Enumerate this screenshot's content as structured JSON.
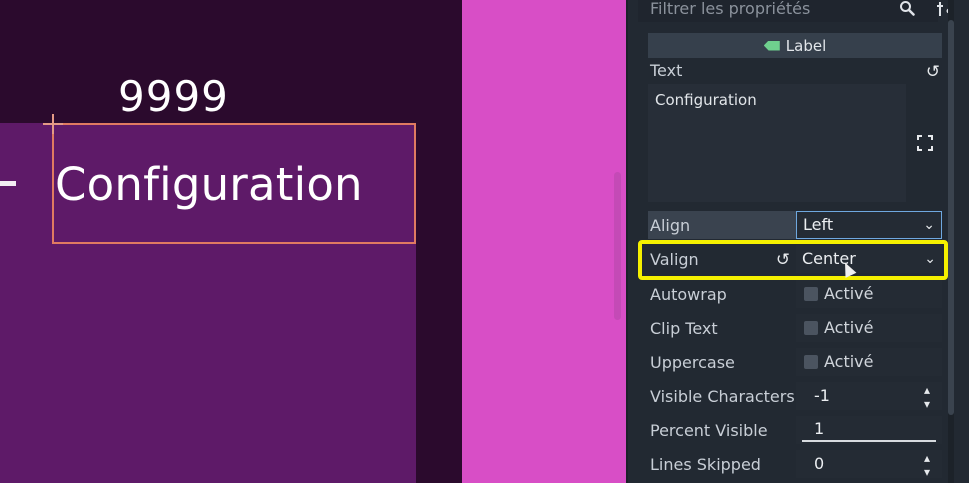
{
  "viewport": {
    "counter_text": "9999",
    "label_text": "Configuration"
  },
  "inspector": {
    "filter": {
      "placeholder": "Filtrer les propriétés",
      "search_icon": "search-icon",
      "tools_icon": "tools-icon"
    },
    "section_header": "Label",
    "text": {
      "label": "Text",
      "value": "Configuration"
    },
    "align": {
      "label": "Align",
      "value": "Left"
    },
    "valign": {
      "label": "Valign",
      "value": "Center"
    },
    "checkboxes": [
      {
        "label": "Autowrap",
        "value_label": "Activé",
        "checked": false
      },
      {
        "label": "Clip Text",
        "value_label": "Activé",
        "checked": false
      },
      {
        "label": "Uppercase",
        "value_label": "Activé",
        "checked": false
      }
    ],
    "visible_characters": {
      "label": "Visible Characters",
      "value": "-1"
    },
    "percent_visible": {
      "label": "Percent Visible",
      "value": "1",
      "fraction": 1
    },
    "lines_skipped": {
      "label": "Lines Skipped",
      "value": "0"
    }
  },
  "colors": {
    "viewport_dark": "#2b0a2d",
    "viewport_purple": "#5e1a68",
    "magenta": "#d84ec6",
    "selection": "#e07b61",
    "highlight": "#f5f000",
    "inspector_bg": "#222932",
    "label_tag": "#6fd08e"
  }
}
